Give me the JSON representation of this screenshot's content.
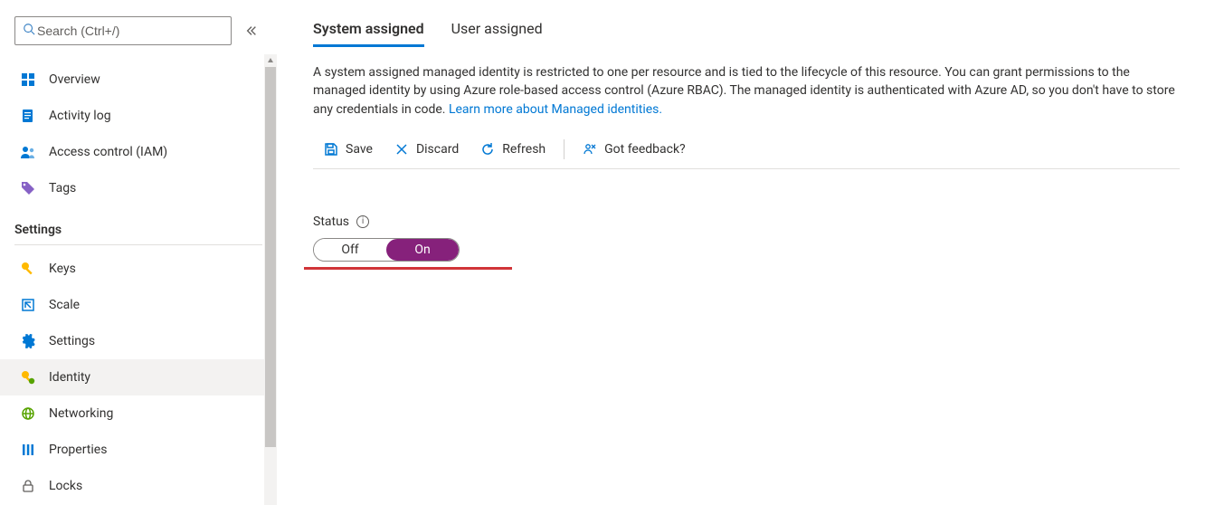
{
  "search": {
    "placeholder": "Search (Ctrl+/)"
  },
  "sidebar": {
    "items": [
      {
        "label": "Overview",
        "icon": "overview-icon"
      },
      {
        "label": "Activity log",
        "icon": "activity-log-icon"
      },
      {
        "label": "Access control (IAM)",
        "icon": "access-control-icon"
      },
      {
        "label": "Tags",
        "icon": "tags-icon"
      }
    ],
    "section_header": "Settings",
    "settings_items": [
      {
        "label": "Keys",
        "icon": "keys-icon"
      },
      {
        "label": "Scale",
        "icon": "scale-icon"
      },
      {
        "label": "Settings",
        "icon": "gear-icon"
      },
      {
        "label": "Identity",
        "icon": "identity-icon",
        "selected": true
      },
      {
        "label": "Networking",
        "icon": "networking-icon"
      },
      {
        "label": "Properties",
        "icon": "properties-icon"
      },
      {
        "label": "Locks",
        "icon": "locks-icon"
      }
    ]
  },
  "tabs": [
    {
      "label": "System assigned",
      "active": true
    },
    {
      "label": "User assigned",
      "active": false
    }
  ],
  "description": {
    "text": "A system assigned managed identity is restricted to one per resource and is tied to the lifecycle of this resource. You can grant permissions to the managed identity by using Azure role-based access control (Azure RBAC). The managed identity is authenticated with Azure AD, so you don't have to store any credentials in code. ",
    "link": "Learn more about Managed identities."
  },
  "toolbar": {
    "save": "Save",
    "discard": "Discard",
    "refresh": "Refresh",
    "feedback": "Got feedback?"
  },
  "status": {
    "label": "Status",
    "off": "Off",
    "on": "On",
    "value": "On"
  }
}
